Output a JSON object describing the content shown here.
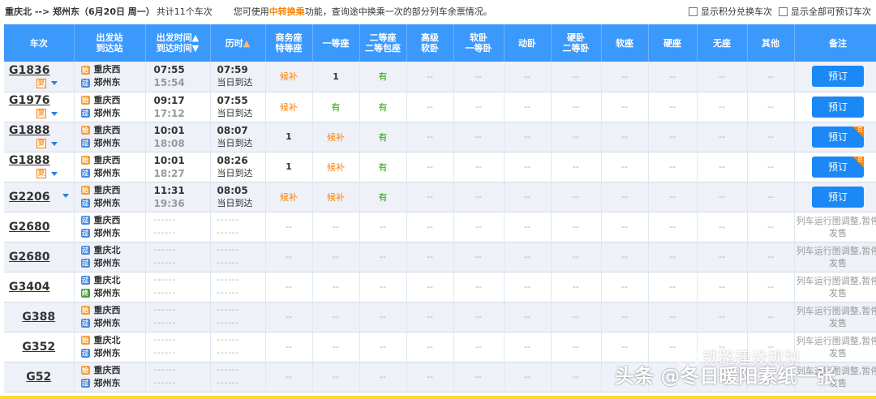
{
  "topbar": {
    "route": "重庆北 --> 郑州东（6月20日 周一）",
    "count": "共计11个车次",
    "notice_pre": "您可使用",
    "notice_hl": "中转换乘",
    "notice_post": "功能，查询途中换乘一次的部分列车余票情况。",
    "opt1": "显示积分兑换车次",
    "opt2": "显示全部可预订车次"
  },
  "headers": {
    "train": "车次",
    "station_1": "出发站",
    "station_2": "到达站",
    "time_1": "出发时间▲",
    "time_2": "到达时间▼",
    "duration": "历时",
    "duration_arrow": "▲",
    "business_1": "商务座",
    "business_2": "特等座",
    "first": "一等座",
    "second_1": "二等座",
    "second_2": "二等包座",
    "soft_high_1": "高级",
    "soft_high_2": "软卧",
    "soft_1": "软卧",
    "soft_2": "一等卧",
    "dongwo": "动卧",
    "hard_1": "硬卧",
    "hard_2": "二等卧",
    "softseat": "软座",
    "hardseat": "硬座",
    "noseat": "无座",
    "other": "其他",
    "remark": "备注"
  },
  "icons": {
    "start": "始",
    "pass": "过",
    "end": "终",
    "fu": "复",
    "corner": "兑"
  },
  "rows": [
    {
      "num": "G1836",
      "fu": true,
      "from": "重庆西",
      "from_type": "start",
      "to": "郑州东",
      "to_type": "pass",
      "dep": "07:55",
      "arr": "15:54",
      "dur": "07:59",
      "note": "当日到达",
      "seats": [
        "候补",
        "1",
        "有",
        "--",
        "--",
        "--",
        "--",
        "--",
        "--",
        "--",
        "--"
      ],
      "action": "预订",
      "corner": false
    },
    {
      "num": "G1976",
      "fu": true,
      "from": "重庆西",
      "from_type": "start",
      "to": "郑州东",
      "to_type": "pass",
      "dep": "09:17",
      "arr": "17:12",
      "dur": "07:55",
      "note": "当日到达",
      "seats": [
        "候补",
        "有",
        "有",
        "--",
        "--",
        "--",
        "--",
        "--",
        "--",
        "--",
        "--"
      ],
      "action": "预订",
      "corner": false
    },
    {
      "num": "G1888",
      "fu": true,
      "from": "重庆西",
      "from_type": "start",
      "to": "郑州东",
      "to_type": "pass",
      "dep": "10:01",
      "arr": "18:08",
      "dur": "08:07",
      "note": "当日到达",
      "seats": [
        "1",
        "候补",
        "有",
        "--",
        "--",
        "--",
        "--",
        "--",
        "--",
        "--",
        "--"
      ],
      "action": "预订",
      "corner": true
    },
    {
      "num": "G1888",
      "fu": true,
      "from": "重庆西",
      "from_type": "start",
      "to": "郑州东",
      "to_type": "pass",
      "dep": "10:01",
      "arr": "18:27",
      "dur": "08:26",
      "note": "当日到达",
      "seats": [
        "1",
        "候补",
        "有",
        "--",
        "--",
        "--",
        "--",
        "--",
        "--",
        "--",
        "--"
      ],
      "action": "预订",
      "corner": true
    },
    {
      "num": "G2206",
      "fu": false,
      "from": "重庆西",
      "from_type": "start",
      "to": "郑州东",
      "to_type": "pass",
      "dep": "11:31",
      "arr": "19:36",
      "dur": "08:05",
      "note": "当日到达",
      "seats": [
        "候补",
        "候补",
        "有",
        "--",
        "--",
        "--",
        "--",
        "--",
        "--",
        "--",
        "--"
      ],
      "action": "预订",
      "corner": false
    },
    {
      "num": "G2680",
      "fu": false,
      "from": "重庆西",
      "from_type": "pass",
      "to": "郑州东",
      "to_type": "pass",
      "dep": "------",
      "arr": "------",
      "dur": "------",
      "note": "------",
      "seats": [
        "--",
        "--",
        "--",
        "--",
        "--",
        "--",
        "--",
        "--",
        "--",
        "--",
        "--"
      ],
      "remark": "列车运行图调整,暂停发售"
    },
    {
      "num": "G2680",
      "fu": false,
      "from": "重庆北",
      "from_type": "pass",
      "to": "郑州东",
      "to_type": "pass",
      "dep": "------",
      "arr": "------",
      "dur": "------",
      "note": "------",
      "seats": [
        "--",
        "--",
        "--",
        "--",
        "--",
        "--",
        "--",
        "--",
        "--",
        "--",
        "--"
      ],
      "remark": "列车运行图调整,暂停发售"
    },
    {
      "num": "G3404",
      "fu": false,
      "from": "重庆北",
      "from_type": "pass",
      "to": "郑州东",
      "to_type": "end",
      "dep": "------",
      "arr": "------",
      "dur": "------",
      "note": "------",
      "seats": [
        "--",
        "--",
        "--",
        "--",
        "--",
        "--",
        "--",
        "--",
        "--",
        "--",
        "--"
      ],
      "remark": "列车运行图调整,暂停发售"
    },
    {
      "num": "G388",
      "fu": false,
      "from": "重庆西",
      "from_type": "start",
      "to": "郑州东",
      "to_type": "pass",
      "dep": "------",
      "arr": "------",
      "dur": "------",
      "note": "------",
      "seats": [
        "--",
        "--",
        "--",
        "--",
        "--",
        "--",
        "--",
        "--",
        "--",
        "--",
        "--"
      ],
      "remark": "列车运行图调整,暂停发售"
    },
    {
      "num": "G352",
      "fu": false,
      "from": "重庆北",
      "from_type": "start",
      "to": "郑州东",
      "to_type": "pass",
      "dep": "------",
      "arr": "------",
      "dur": "------",
      "note": "------",
      "seats": [
        "--",
        "--",
        "--",
        "--",
        "--",
        "--",
        "--",
        "--",
        "--",
        "--",
        "--"
      ],
      "remark": "列车运行图调整,暂停发售"
    },
    {
      "num": "G52",
      "fu": false,
      "from": "重庆西",
      "from_type": "start",
      "to": "郑州东",
      "to_type": "pass",
      "dep": "------",
      "arr": "------",
      "dur": "------",
      "note": "------",
      "seats": [
        "--",
        "--",
        "--",
        "--",
        "--",
        "--",
        "--",
        "--",
        "--",
        "--",
        "--"
      ],
      "remark": "列车运行图调整,暂停发售"
    }
  ],
  "watermark": {
    "line1": "铁路建设规划",
    "line2": "头条 @冬日暖阳素纸一张"
  },
  "colors": {
    "header_bg": "#3b99fc",
    "button_bg": "#1a88f5",
    "waitlist": "#fc8302",
    "available": "#26a306"
  }
}
